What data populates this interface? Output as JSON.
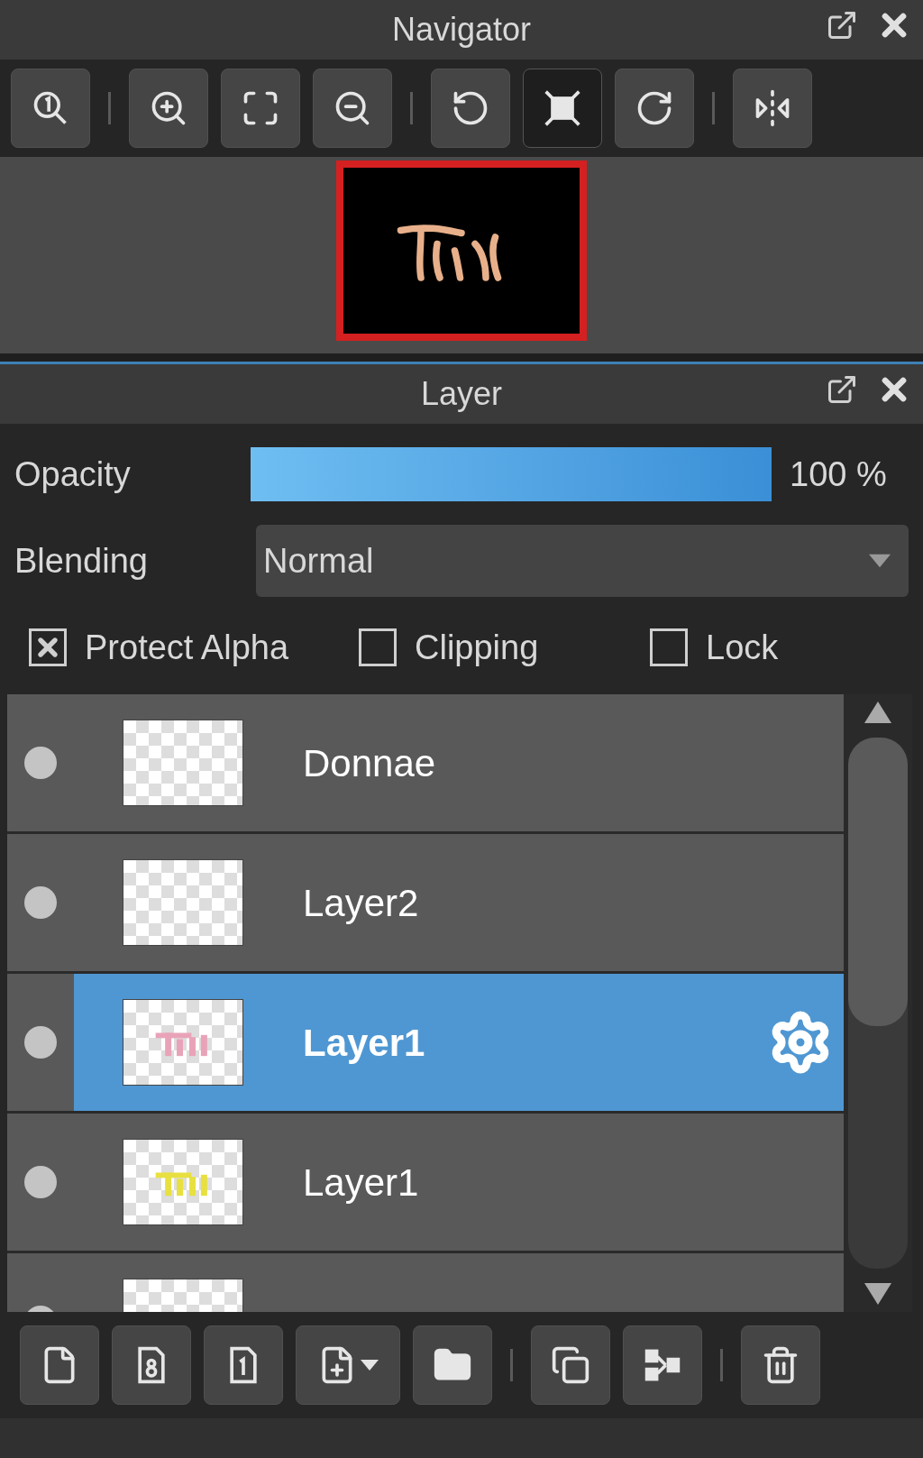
{
  "navigator": {
    "title": "Navigator",
    "toolbar": [
      {
        "kind": "zoom-actual",
        "selected": false
      },
      {
        "kind": "separator"
      },
      {
        "kind": "zoom-in",
        "selected": false
      },
      {
        "kind": "fit",
        "selected": false
      },
      {
        "kind": "zoom-out",
        "selected": false
      },
      {
        "kind": "separator"
      },
      {
        "kind": "rotate-left",
        "selected": false
      },
      {
        "kind": "fit-screen",
        "selected": true
      },
      {
        "kind": "rotate-right",
        "selected": false
      },
      {
        "kind": "separator"
      },
      {
        "kind": "flip",
        "selected": false
      }
    ]
  },
  "layer_panel": {
    "title": "Layer",
    "opacity": {
      "label": "Opacity",
      "level": 1,
      "reading": "100 %"
    },
    "blending": {
      "label": "Blending",
      "value": "Normal"
    },
    "options": [
      {
        "label": "Protect Alpha",
        "checked": true
      },
      {
        "label": "Clipping",
        "checked": false
      },
      {
        "label": "Lock",
        "checked": false
      }
    ],
    "layers": [
      {
        "name": "Donnae",
        "selected": false,
        "kind": "blank"
      },
      {
        "name": "Layer2",
        "selected": false,
        "kind": "blank"
      },
      {
        "name": "Layer1",
        "selected": true,
        "kind": "marks",
        "color": "#e9a3b8"
      },
      {
        "name": "Layer1",
        "selected": false,
        "kind": "marks",
        "color": "#e8e040"
      },
      {
        "selected": false,
        "kind": "blank"
      }
    ],
    "bottom_toolbar": [
      {
        "kind": "new-layer"
      },
      {
        "kind": "new-8bit"
      },
      {
        "kind": "new-1bit"
      },
      {
        "kind": "add-menu"
      },
      {
        "kind": "folder"
      },
      {
        "kind": "separator"
      },
      {
        "kind": "duplicate"
      },
      {
        "kind": "merge"
      },
      {
        "kind": "separator"
      },
      {
        "kind": "delete"
      }
    ]
  }
}
